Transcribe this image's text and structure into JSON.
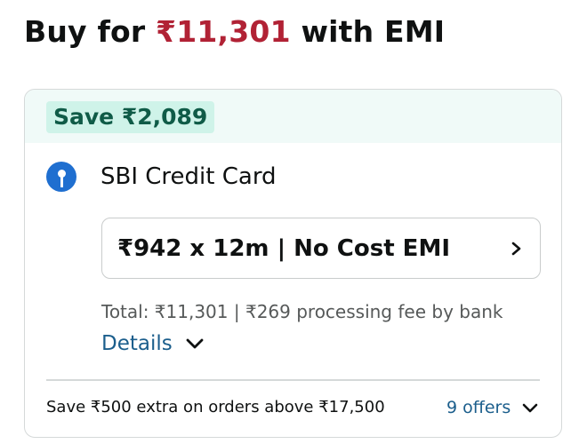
{
  "headline": {
    "prefix": "Buy for ",
    "price": "₹11,301",
    "suffix": " with EMI"
  },
  "card": {
    "save_badge": "Save ₹2,089",
    "bank": {
      "name": "SBI Credit Card",
      "logo_icon": "sbi-logo-icon",
      "logo_color": "#1f6fd0"
    },
    "emi_option": {
      "label": "₹942 x 12m | No Cost EMI",
      "icon": "chevron-right-icon"
    },
    "total_line": "Total: ₹11,301 | ₹269 processing fee by bank",
    "details": {
      "label": "Details",
      "icon": "chevron-down-icon"
    },
    "offer": {
      "text": "Save ₹500 extra on orders above ₹17,500",
      "offers_link": "9 offers",
      "icon": "chevron-down-icon"
    }
  },
  "colors": {
    "price_red": "#b12235",
    "save_text": "#0f5b47",
    "save_bg": "#cff3e9",
    "link_blue": "#1b5e8c",
    "band_bg": "#f0faf8"
  }
}
